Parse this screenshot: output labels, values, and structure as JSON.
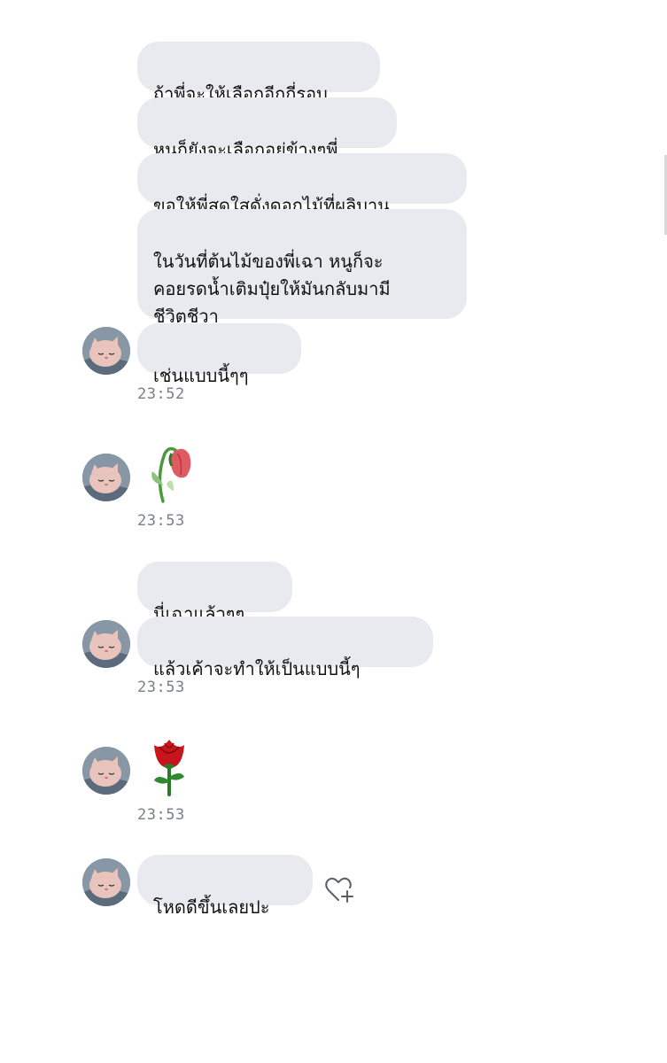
{
  "conversation": {
    "messages": [
      {
        "text": "ถ้าพี่จะให้เลือกอีกกี่รอบ"
      },
      {
        "text": "หนูก็ยังจะเลือกอยู่ข้างๆพี่"
      },
      {
        "text": "ขอให้พี่สดใสดั่งดอกไม้ที่ผลิบาน"
      },
      {
        "text": "ในวันที่ต้นไม้ของพี่เฉา หนูก็จะ\nคอยรดน้ำเติมปุ๋ยให้มันกลับมามี\nชีวิตชีวา"
      },
      {
        "text": "เช่นแบบนี้ๆๆ",
        "time": "23:52"
      },
      {
        "emoji": "wilted-flower-emoji",
        "time": "23:53"
      },
      {
        "text": "นี่เฉาแล้วๆๆ"
      },
      {
        "text": "แล้วเค้าจะทำให้เป็นแบบนี้ๆ",
        "time": "23:53"
      },
      {
        "emoji": "rose-emoji",
        "time": "23:53"
      },
      {
        "text": "โหดดีขึ้นเลยปะ"
      }
    ]
  },
  "icons": {
    "avatar": "sleeping-cat-avatar",
    "reaction": "heart-plus-icon"
  },
  "colors": {
    "bubble_bg": "#e9eaef",
    "text": "#111111",
    "timestamp": "#7a7e88",
    "rose": "#c8141c",
    "stem": "#2a7a2a"
  }
}
